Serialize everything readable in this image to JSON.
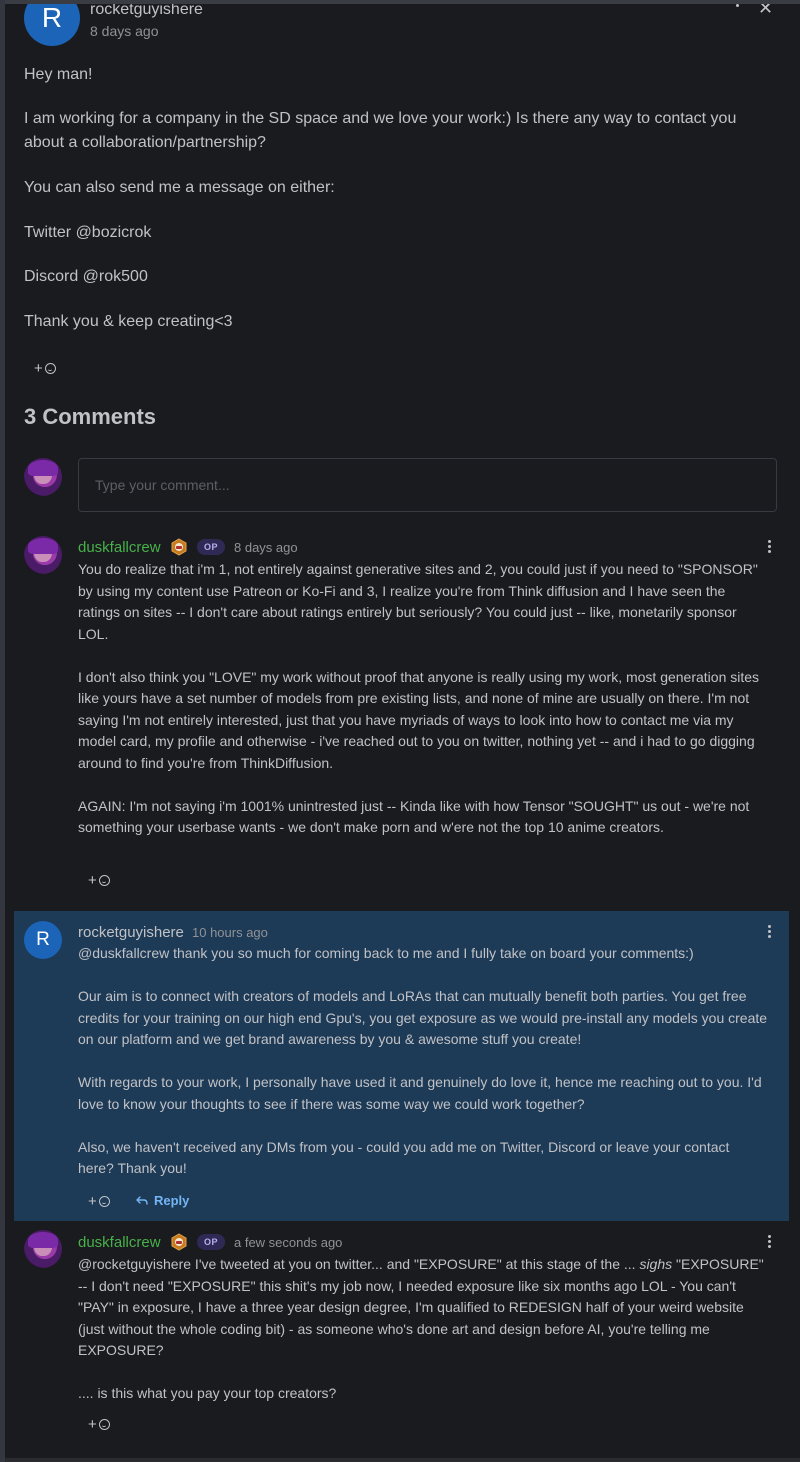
{
  "post": {
    "author": "rocketguyishere",
    "avatar_letter": "R",
    "time": "8 days ago",
    "paragraphs": [
      "Hey man!",
      "I am working for a company in the SD space and we love your work:) Is there any way to contact you about a collaboration/partnership?",
      "You can also send me a message on either:",
      "Twitter @bozicrok",
      "Discord @rok500",
      "Thank you & keep creating<3"
    ],
    "react_label": "+"
  },
  "comments_header": "3 Comments",
  "comment_input": {
    "placeholder": "Type your comment..."
  },
  "comments": [
    {
      "author": "duskfallcrew",
      "badge": "OP",
      "time": "8 days ago",
      "text": "You do realize that i'm 1, not entirely against generative sites and 2, you could just if you need to \"SPONSOR\" by using my content use Patreon or Ko-Fi and 3, I realize you're from Think diffusion and I have seen the ratings on sites -- I don't care about ratings entirely but seriously? You could just -- like, monetarily sponsor LOL.\n\nI don't also think you \"LOVE\" my work without proof that anyone is really using my work, most generation sites like yours have a set number of models from pre existing lists, and none of mine are usually on there. I'm not saying I'm not entirely interested, just that you have myriads of ways to look into how to contact me via my model card, my profile and otherwise - i've reached out to you on twitter, nothing yet -- and i had to go digging around to find you're from ThinkDiffusion.\n\nAGAIN: I'm not saying i'm 1001% unintrested just -- Kinda like with how Tensor \"SOUGHT\" us out - we're not something your userbase wants - we don't make porn and w'ere not the top 10 anime creators.",
      "react_label": "+"
    },
    {
      "author": "rocketguyishere",
      "avatar_letter": "R",
      "time": "10 hours ago",
      "text": "@duskfallcrew thank you so much for coming back to me and I fully take on board your comments:)\n\nOur aim is to connect with creators of models and LoRAs that can mutually benefit both parties. You get free credits for your training on our high end Gpu's, you get exposure as we would pre-install any models you create on our platform and we get brand awareness by you & awesome stuff you create!\n\nWith regards to your work, I personally have used it and genuinely do love it, hence me reaching out to you. I'd love to know your thoughts to see if there was some way we could work together?\n\nAlso, we haven't received any DMs from you - could you add me on Twitter, Discord or leave your contact here? Thank you!",
      "react_label": "+",
      "reply_label": "Reply"
    },
    {
      "author": "duskfallcrew",
      "badge": "OP",
      "time": "a few seconds ago",
      "text_before_em": "@rocketguyishere I've tweeted at you on twitter... and \"EXPOSURE\" at this stage of the ... ",
      "text_em": "sighs",
      "text_after_em": " \"EXPOSURE\" -- I don't need \"EXPOSURE\" this shit's my job now, I needed exposure like six months ago LOL - You can't \"PAY\" in exposure, I have a three year design degree, I'm qualified to REDESIGN half of your weird website (just without the whole coding bit) - as someone who's done art and design before AI, you're telling me EXPOSURE?\n\n.... is this what you pay your top creators?",
      "react_label": "+"
    }
  ],
  "colors": {
    "modal_bg": "#1a1b1e",
    "highlight_bg": "#1d3a57",
    "username_green": "#47b14a",
    "avatar_blue": "#1c64b8",
    "reply_blue": "#74b5f4"
  }
}
